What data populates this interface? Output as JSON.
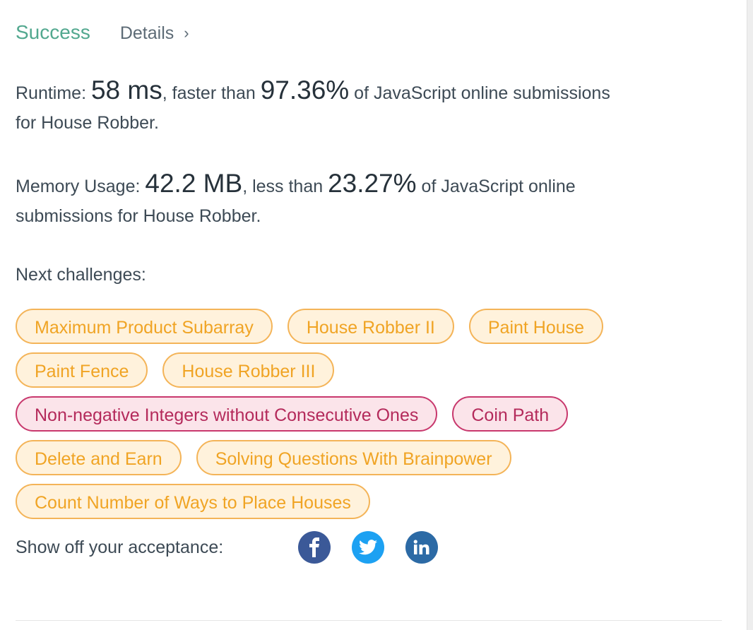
{
  "status": {
    "label": "Success",
    "details_label": "Details",
    "chevron": "›"
  },
  "runtime": {
    "prefix": "Runtime: ",
    "value": "58 ms",
    "middle": ", faster than ",
    "percent": "97.36%",
    "suffix_line1": " of JavaScript online submissions",
    "suffix_line2": "for House Robber."
  },
  "memory": {
    "prefix": "Memory Usage: ",
    "value": "42.2 MB",
    "middle": ", less than ",
    "percent": "23.27%",
    "suffix_line1": " of JavaScript online",
    "suffix_line2": "submissions for House Robber."
  },
  "next": {
    "label": "Next challenges:",
    "rows": [
      [
        {
          "label": "Maximum Product Subarray",
          "difficulty": "medium"
        },
        {
          "label": "House Robber II",
          "difficulty": "medium"
        },
        {
          "label": "Paint House",
          "difficulty": "medium"
        }
      ],
      [
        {
          "label": "Paint Fence",
          "difficulty": "medium"
        },
        {
          "label": "House Robber III",
          "difficulty": "medium"
        }
      ],
      [
        {
          "label": "Non-negative Integers without Consecutive Ones",
          "difficulty": "hard"
        },
        {
          "label": "Coin Path",
          "difficulty": "hard"
        }
      ],
      [
        {
          "label": "Delete and Earn",
          "difficulty": "medium"
        },
        {
          "label": "Solving Questions With Brainpower",
          "difficulty": "medium"
        }
      ],
      [
        {
          "label": "Count Number of Ways to Place Houses",
          "difficulty": "medium"
        }
      ]
    ]
  },
  "share": {
    "label": "Show off your acceptance:",
    "icons": [
      "facebook-icon",
      "twitter-icon",
      "linkedin-icon"
    ]
  },
  "colors": {
    "success": "#52a88f",
    "medium_text": "#f0a424",
    "medium_bg": "#fff2dc",
    "hard_text": "#b42a5b",
    "hard_bg": "#fbe4ea",
    "facebook": "#3b5998",
    "twitter": "#1da1f2",
    "linkedin": "#2c6aa5"
  }
}
